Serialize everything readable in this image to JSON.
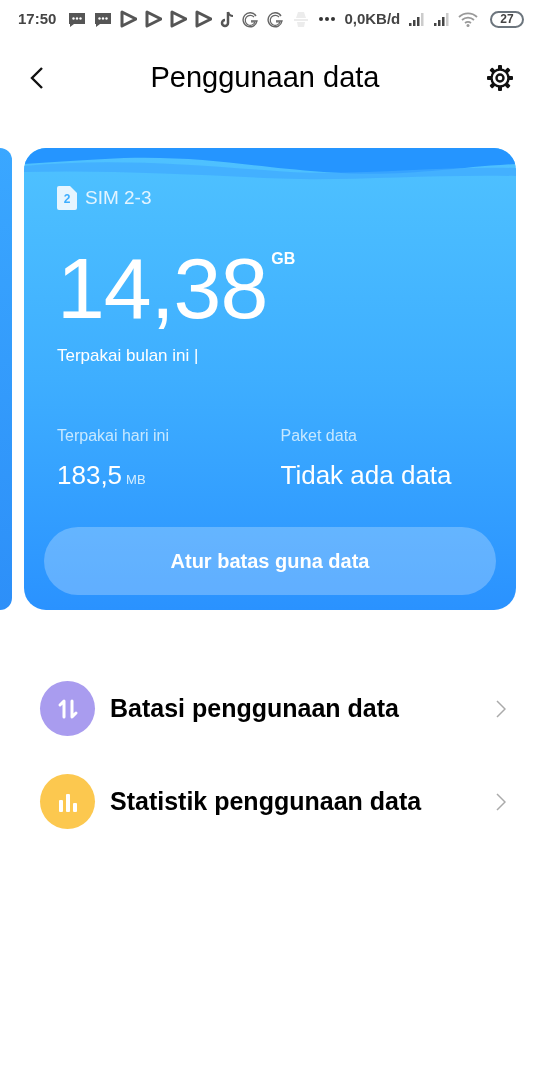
{
  "status_bar": {
    "time": "17:50",
    "speed": "0,0KB/d",
    "battery": "27"
  },
  "header": {
    "title": "Penggunaan data"
  },
  "sim_card": {
    "sim_label": "SIM 2-3",
    "sim_number": "2",
    "used_month": "14,38",
    "used_month_unit": "GB",
    "used_month_label": "Terpakai bulan ini |",
    "used_today_label": "Terpakai hari ini",
    "used_today": "183,5",
    "used_today_unit": "MB",
    "plan_label": "Paket data",
    "plan_value": "Tidak ada data",
    "button": "Atur batas guna data"
  },
  "menu": [
    {
      "kind": "transfer",
      "label": "Batasi penggunaan data",
      "color": "#a99cef"
    },
    {
      "kind": "chart",
      "label": "Statistik penggunaan data",
      "color": "#fcc84f"
    }
  ]
}
